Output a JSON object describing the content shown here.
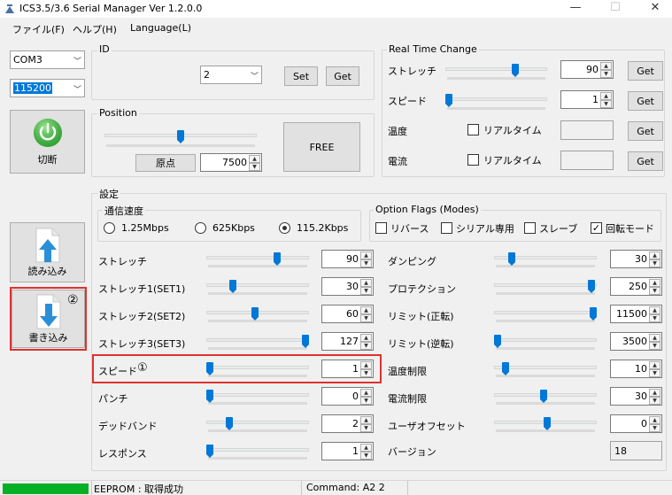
{
  "window": {
    "title": "ICS3.5/3.6 Serial Manager  Ver 1.2.0.0",
    "minimize": "—",
    "maximize": "☐",
    "close": "✕"
  },
  "menu": [
    "ファイル(F)",
    "ヘルプ(H)",
    "Language(L)"
  ],
  "connection": {
    "port": "COM3",
    "baud": "115200",
    "disconnect_label": "切断"
  },
  "id_group": {
    "title": "ID",
    "value": "2",
    "set_label": "Set",
    "get_label": "Get"
  },
  "position": {
    "title": "Position",
    "origin_label": "原点",
    "value": "7500",
    "slider_fraction": 0.5,
    "free_label": "FREE"
  },
  "realtime": {
    "title": "Real Time Change",
    "stretch_label": "ストレッチ",
    "stretch_value": "90",
    "stretch_fraction": 0.7,
    "speed_label": "スピード",
    "speed_value": "1",
    "speed_fraction": 0.0,
    "temp_label": "温度",
    "current_label": "電流",
    "realtime_label": "リアルタイム",
    "get_label": "Get"
  },
  "settings": {
    "title": "設定",
    "comm_title": "通信速度",
    "speeds": [
      "1.25Mbps",
      "625Kbps",
      "115.2Kbps"
    ],
    "selected_speed": 2,
    "flags_title": "Option Flags (Modes)",
    "flags": [
      {
        "label": "リバース",
        "checked": false
      },
      {
        "label": "シリアル専用",
        "checked": false
      },
      {
        "label": "スレーブ",
        "checked": false
      },
      {
        "label": "回転モード",
        "checked": true
      }
    ],
    "left": [
      {
        "label": "ストレッチ",
        "value": "90",
        "fraction": 0.7
      },
      {
        "label": "ストレッチ1(SET1)",
        "value": "30",
        "fraction": 0.24
      },
      {
        "label": "ストレッチ2(SET2)",
        "value": "60",
        "fraction": 0.47
      },
      {
        "label": "ストレッチ3(SET3)",
        "value": "127",
        "fraction": 1.0
      },
      {
        "label": "スピード",
        "value": "1",
        "fraction": 0.0
      },
      {
        "label": "パンチ",
        "value": "0",
        "fraction": 0.0
      },
      {
        "label": "デッドバンド",
        "value": "2",
        "fraction": 0.2
      },
      {
        "label": "レスポンス",
        "value": "1",
        "fraction": 0.0
      }
    ],
    "right": [
      {
        "label": "ダンピング",
        "value": "30",
        "fraction": 0.15
      },
      {
        "label": "プロテクション",
        "value": "250",
        "fraction": 0.98
      },
      {
        "label": "リミット(正転)",
        "value": "11500",
        "fraction": 1.0
      },
      {
        "label": "リミット(逆転)",
        "value": "3500",
        "fraction": 0.0
      },
      {
        "label": "温度制限",
        "value": "10",
        "fraction": 0.08
      },
      {
        "label": "電流制限",
        "value": "30",
        "fraction": 0.48
      },
      {
        "label": "ユーザオフセット",
        "value": "0",
        "fraction": 0.52
      }
    ],
    "version_label": "バージョン",
    "version_value": "18"
  },
  "annotations": {
    "speed_marker": "①",
    "write_marker": "②"
  },
  "actions": {
    "read_label": "読み込み",
    "write_label": "書き込み"
  },
  "status": {
    "eeprom": "EEPROM : 取得成功",
    "command": "Command: A2 2"
  },
  "colors": {
    "accent": "#0078d7",
    "power_green": "#3cb043",
    "status_green": "#06b025",
    "highlight_red": "#e03030"
  }
}
